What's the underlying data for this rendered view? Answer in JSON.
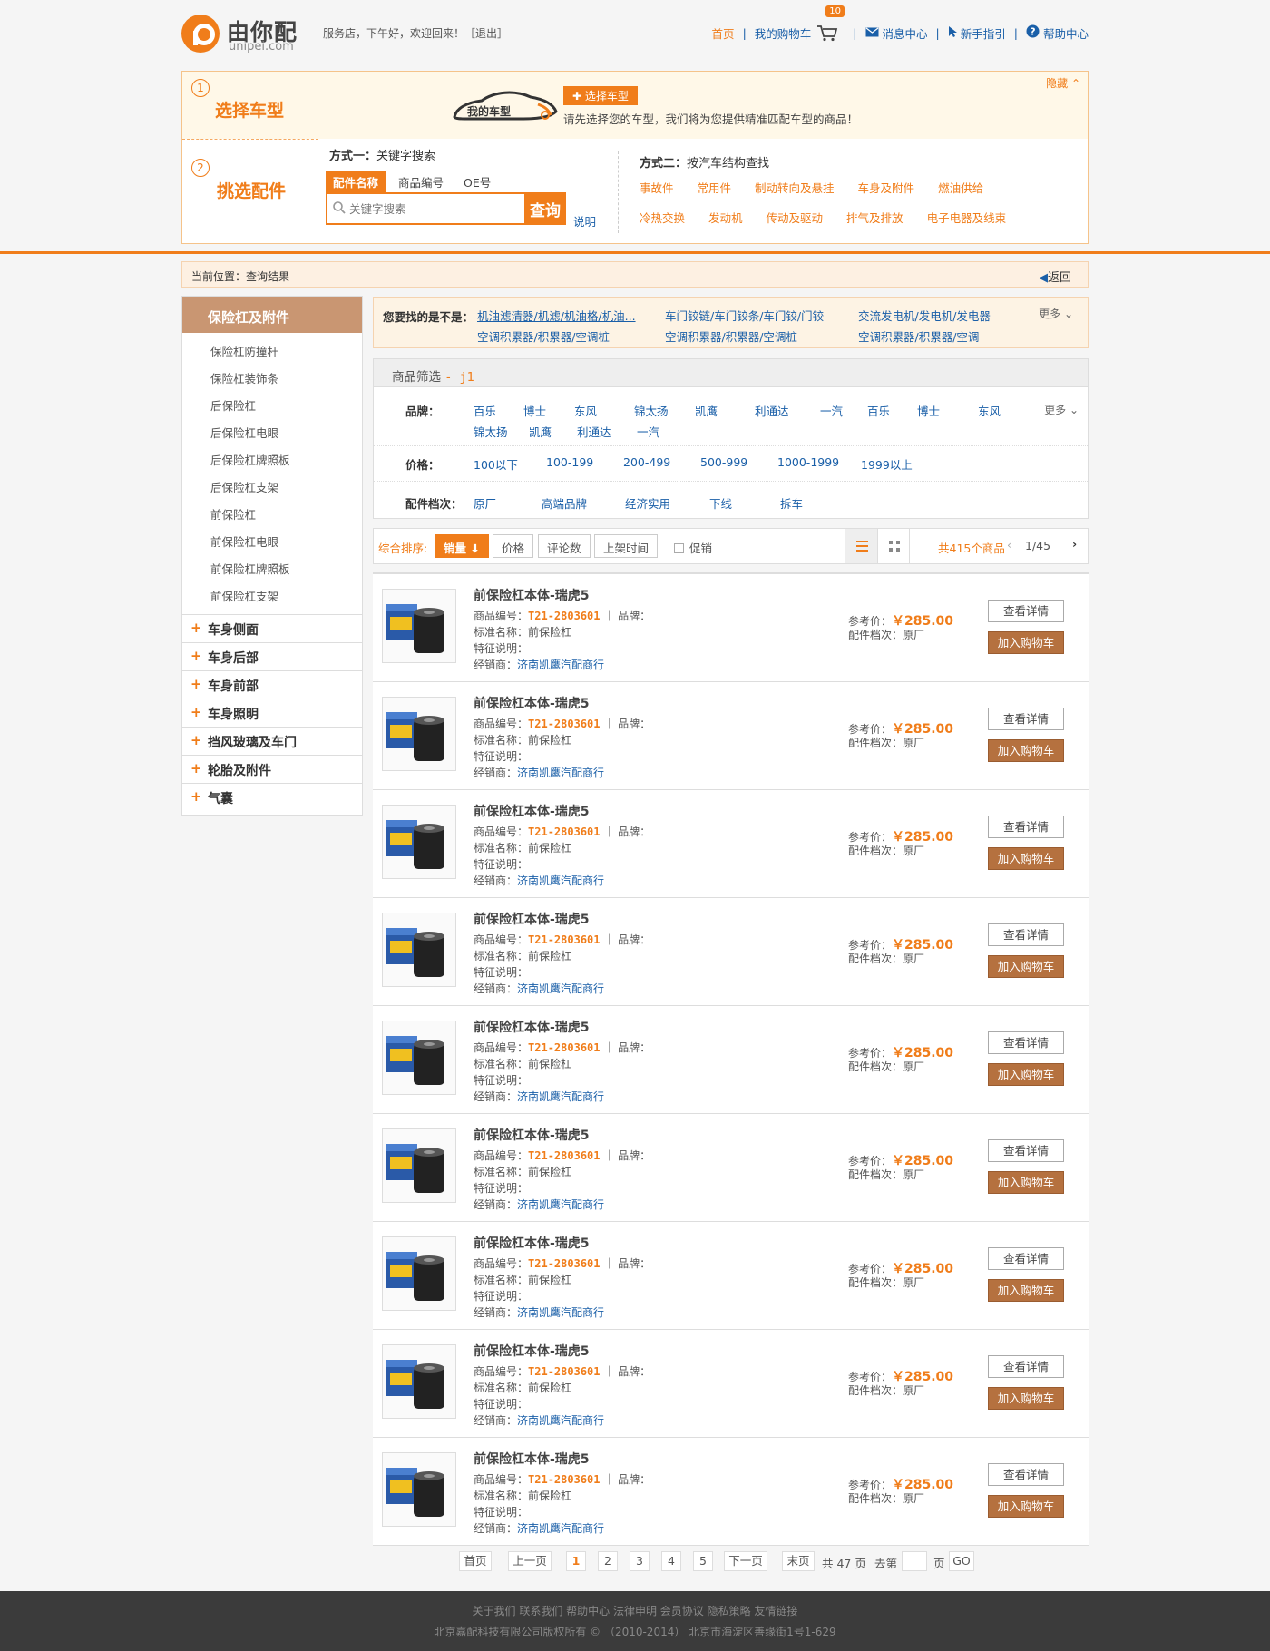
{
  "header": {
    "logo_text": "由你配",
    "logo_sub": "unipei.com",
    "greeting": "服务店，下午好，欢迎回来！［退出］",
    "nav": {
      "home": "首页",
      "cart": "我的购物车",
      "cart_count": "10",
      "messages": "消息中心",
      "guide": "新手指引",
      "help": "帮助中心"
    }
  },
  "select_panel": {
    "step1_num": "1",
    "step1_title": "选择车型",
    "car_badge": "我的车型",
    "select_car_btn": "✚ 选择车型",
    "car_tip": "请先选择您的车型，我们将为您提供精准匹配车型的商品！",
    "hide": "隐藏",
    "step2_num": "2",
    "step2_title": "挑选配件",
    "method1_label": "方式一：",
    "method1_text": "关键字搜索",
    "tabs": [
      "配件名称",
      "商品编号",
      "OE号"
    ],
    "search_placeholder": "关键字搜索",
    "search_btn": "查询",
    "explain": "说明",
    "method2_label": "方式二：",
    "method2_text": "按汽车结构查找",
    "categories": [
      "事故件",
      "常用件",
      "制动转向及悬挂",
      "车身及附件",
      "燃油供给",
      "冷热交换",
      "发动机",
      "传动及驱动",
      "排气及排放",
      "电子电器及线束"
    ]
  },
  "breadcrumb": {
    "text": "当前位置：查询结果",
    "back": "返回"
  },
  "sidebar": {
    "head": "保险杠及附件",
    "sub_items": [
      "保险杠防撞杆",
      "保险杠装饰条",
      "后保险杠",
      "后保险杠电眼",
      "后保险杠牌照板",
      "后保险杠支架",
      "前保险杠",
      "前保险杠电眼",
      "前保险杠牌照板",
      "前保险杠支架"
    ],
    "categories": [
      "车身侧面",
      "车身后部",
      "车身前部",
      "车身照明",
      "挡风玻璃及车门",
      "轮胎及附件",
      "气囊"
    ]
  },
  "suggest": {
    "label": "您要找的是不是：",
    "items": [
      "机油滤清器/机滤/机油格/机油...",
      "车门铰链/车门铰条/车门铰/门铰",
      "交流发电机/发电机/发电器",
      "空调积累器/积累器/空调桩",
      "空调积累器/积累器/空调桩",
      "空调积累器/积累器/空调"
    ],
    "more": "更多"
  },
  "filter": {
    "title": "商品筛选",
    "keyword": "- j1",
    "brand_label": "品牌：",
    "brands": [
      "百乐",
      "博士",
      "东风",
      "锦太扬",
      "凯鹰",
      "利通达",
      "一汽",
      "百乐",
      "博士",
      "东风",
      "锦太扬",
      "凯鹰",
      "利通达",
      "一汽"
    ],
    "brand_more": "更多",
    "price_label": "价格：",
    "prices": [
      "100以下",
      "100-199",
      "200-499",
      "500-999",
      "1000-1999",
      "1999以上"
    ],
    "grade_label": "配件档次：",
    "grades": [
      "原厂",
      "高端品牌",
      "经济实用",
      "下线",
      "拆车"
    ]
  },
  "sort": {
    "label": "综合排序:",
    "sales": "销量 ⬇",
    "price": "价格",
    "reviews": "评论数",
    "listed": "上架时间",
    "promo": "促销",
    "total": "共415个商品",
    "page": "1/45"
  },
  "products": [
    {
      "title": "前保险杠本体-瑞虎5",
      "code_label": "商品编号：",
      "code": "T21-2803601",
      "brand_label": "｜ 品牌：",
      "std_label": "标准名称：",
      "std": "前保险杠",
      "feature_label": "特征说明：",
      "dealer_label": "经销商：",
      "dealer": "济南凯鹰汽配商行",
      "price_label": "参考价：",
      "price": "￥285.00",
      "grade_label": "配件档次：",
      "grade": "原厂",
      "detail_btn": "查看详情",
      "cart_btn": "加入购物车"
    },
    {
      "title": "前保险杠本体-瑞虎5",
      "code_label": "商品编号：",
      "code": "T21-2803601",
      "brand_label": "｜ 品牌：",
      "std_label": "标准名称：",
      "std": "前保险杠",
      "feature_label": "特征说明：",
      "dealer_label": "经销商：",
      "dealer": "济南凯鹰汽配商行",
      "price_label": "参考价：",
      "price": "￥285.00",
      "grade_label": "配件档次：",
      "grade": "原厂",
      "detail_btn": "查看详情",
      "cart_btn": "加入购物车"
    },
    {
      "title": "前保险杠本体-瑞虎5",
      "code_label": "商品编号：",
      "code": "T21-2803601",
      "brand_label": "｜ 品牌：",
      "std_label": "标准名称：",
      "std": "前保险杠",
      "feature_label": "特征说明：",
      "dealer_label": "经销商：",
      "dealer": "济南凯鹰汽配商行",
      "price_label": "参考价：",
      "price": "￥285.00",
      "grade_label": "配件档次：",
      "grade": "原厂",
      "detail_btn": "查看详情",
      "cart_btn": "加入购物车"
    },
    {
      "title": "前保险杠本体-瑞虎5",
      "code_label": "商品编号：",
      "code": "T21-2803601",
      "brand_label": "｜ 品牌：",
      "std_label": "标准名称：",
      "std": "前保险杠",
      "feature_label": "特征说明：",
      "dealer_label": "经销商：",
      "dealer": "济南凯鹰汽配商行",
      "price_label": "参考价：",
      "price": "￥285.00",
      "grade_label": "配件档次：",
      "grade": "原厂",
      "detail_btn": "查看详情",
      "cart_btn": "加入购物车"
    },
    {
      "title": "前保险杠本体-瑞虎5",
      "code_label": "商品编号：",
      "code": "T21-2803601",
      "brand_label": "｜ 品牌：",
      "std_label": "标准名称：",
      "std": "前保险杠",
      "feature_label": "特征说明：",
      "dealer_label": "经销商：",
      "dealer": "济南凯鹰汽配商行",
      "price_label": "参考价：",
      "price": "￥285.00",
      "grade_label": "配件档次：",
      "grade": "原厂",
      "detail_btn": "查看详情",
      "cart_btn": "加入购物车"
    },
    {
      "title": "前保险杠本体-瑞虎5",
      "code_label": "商品编号：",
      "code": "T21-2803601",
      "brand_label": "｜ 品牌：",
      "std_label": "标准名称：",
      "std": "前保险杠",
      "feature_label": "特征说明：",
      "dealer_label": "经销商：",
      "dealer": "济南凯鹰汽配商行",
      "price_label": "参考价：",
      "price": "￥285.00",
      "grade_label": "配件档次：",
      "grade": "原厂",
      "detail_btn": "查看详情",
      "cart_btn": "加入购物车"
    },
    {
      "title": "前保险杠本体-瑞虎5",
      "code_label": "商品编号：",
      "code": "T21-2803601",
      "brand_label": "｜ 品牌：",
      "std_label": "标准名称：",
      "std": "前保险杠",
      "feature_label": "特征说明：",
      "dealer_label": "经销商：",
      "dealer": "济南凯鹰汽配商行",
      "price_label": "参考价：",
      "price": "￥285.00",
      "grade_label": "配件档次：",
      "grade": "原厂",
      "detail_btn": "查看详情",
      "cart_btn": "加入购物车"
    },
    {
      "title": "前保险杠本体-瑞虎5",
      "code_label": "商品编号：",
      "code": "T21-2803601",
      "brand_label": "｜ 品牌：",
      "std_label": "标准名称：",
      "std": "前保险杠",
      "feature_label": "特征说明：",
      "dealer_label": "经销商：",
      "dealer": "济南凯鹰汽配商行",
      "price_label": "参考价：",
      "price": "￥285.00",
      "grade_label": "配件档次：",
      "grade": "原厂",
      "detail_btn": "查看详情",
      "cart_btn": "加入购物车"
    },
    {
      "title": "前保险杠本体-瑞虎5",
      "code_label": "商品编号：",
      "code": "T21-2803601",
      "brand_label": "｜ 品牌：",
      "std_label": "标准名称：",
      "std": "前保险杠",
      "feature_label": "特征说明：",
      "dealer_label": "经销商：",
      "dealer": "济南凯鹰汽配商行",
      "price_label": "参考价：",
      "price": "￥285.00",
      "grade_label": "配件档次：",
      "grade": "原厂",
      "detail_btn": "查看详情",
      "cart_btn": "加入购物车"
    }
  ],
  "pager": {
    "first": "首页",
    "prev": "上一页",
    "pages": [
      "1",
      "2",
      "3",
      "4",
      "5"
    ],
    "next": "下一页",
    "last": "末页",
    "total": "共 47 页",
    "goto": "去第",
    "page_unit": "页",
    "go": "GO"
  },
  "footer": {
    "links": "关于我们  联系我们  帮助中心  法律申明  会员协议  隐私策略  友情链接",
    "copyright": "北京嘉配科技有限公司版权所有 © （2010-2014） 北京市海淀区善缘街1号1-629"
  },
  "colors": {
    "accent": "#f07d1a",
    "link": "#1a5fa8",
    "sidebar_head": "#c99672",
    "cart_button": "#b5713f"
  }
}
